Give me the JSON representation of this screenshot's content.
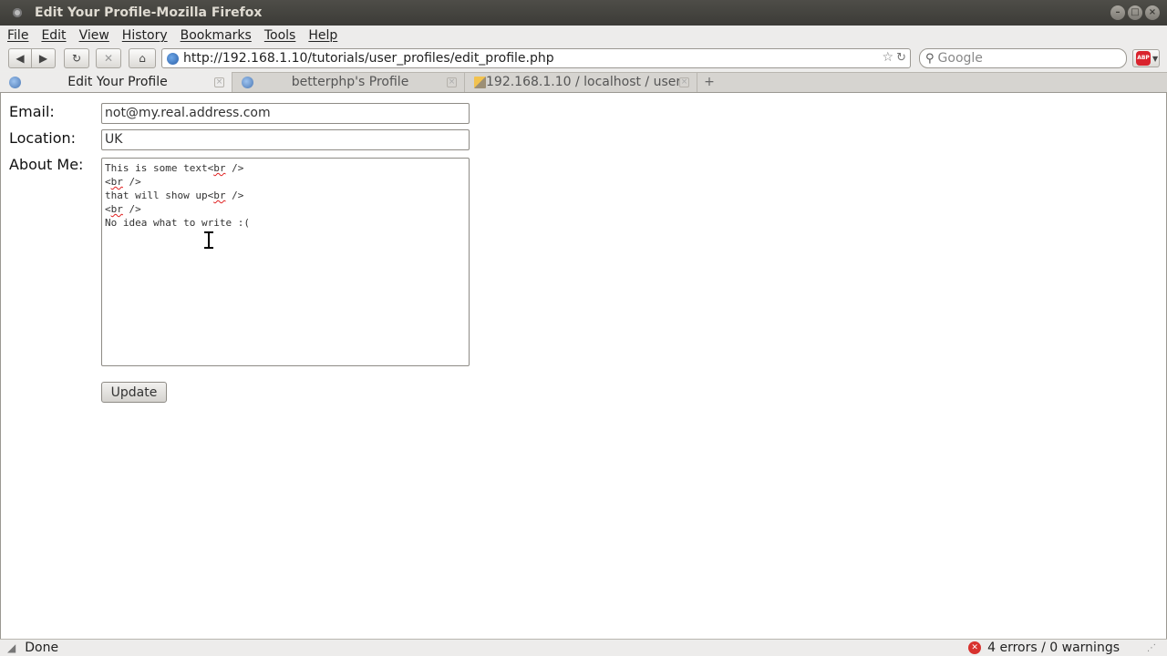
{
  "window": {
    "title": "Edit Your Profile-Mozilla Firefox"
  },
  "menu": [
    "File",
    "Edit",
    "View",
    "History",
    "Bookmarks",
    "Tools",
    "Help"
  ],
  "nav": {
    "url": "http://192.168.1.10/tutorials/user_profiles/edit_profile.php",
    "search_placeholder": "Google",
    "abp_label": "ABP"
  },
  "tabs": [
    {
      "label": "Edit Your Profile",
      "active": true
    },
    {
      "label": "betterphp's Profile",
      "active": false
    },
    {
      "label": "192.168.1.10 / localhost / user...",
      "active": false
    }
  ],
  "form": {
    "email_label": "Email:",
    "email_value": "not@my.real.address.com",
    "location_label": "Location:",
    "location_value": "UK",
    "about_label": "About Me:",
    "about_lines": [
      {
        "pre": "This is some text<",
        "tag": "br",
        "post": " />"
      },
      {
        "pre": "<",
        "tag": "br",
        "post": " />"
      },
      {
        "pre": "that will show up<",
        "tag": "br",
        "post": " />"
      },
      {
        "pre": "<",
        "tag": "br",
        "post": " />"
      },
      {
        "pre": "No idea what to write :(",
        "tag": "",
        "post": ""
      }
    ],
    "update_label": "Update"
  },
  "status": {
    "text": "Done",
    "errors": "4 errors / 0 warnings"
  }
}
